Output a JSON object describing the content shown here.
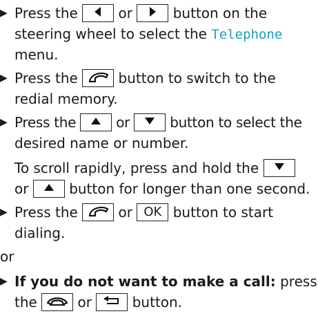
{
  "bullet": "▶",
  "steps": [
    {
      "t1": "Press the",
      "t2": "or",
      "t3": "button on the",
      "line2a": "steering wheel to select the",
      "menu": "Telephone",
      "line3": "menu."
    },
    {
      "t1": "Press the",
      "t2": "button to switch to the",
      "line2": "redial memory."
    },
    {
      "t1": "Press the",
      "t2": "or",
      "t3": "button to select the",
      "line2": "desired name or number."
    },
    {
      "n1": "To scroll rapidly, press and hold the",
      "n2": "or",
      "n3": "button for longer than one second."
    },
    {
      "t1": "Press the",
      "t2": "or",
      "ok": "OK",
      "t3": "button to start",
      "line2": "dialing."
    }
  ],
  "or_separator": "or",
  "final": {
    "bold": "If you do not want to make a call:",
    "t1": "press",
    "t2": "the",
    "t3": "or",
    "t4": "button."
  },
  "icons": [
    "left-triangle-icon",
    "right-triangle-icon",
    "phone-pickup-icon",
    "up-triangle-icon",
    "down-triangle-icon",
    "phone-hangup-icon",
    "back-arrow-icon"
  ],
  "colors": {
    "menu_text": "#1f9cc3",
    "text": "#1a1a1a"
  }
}
